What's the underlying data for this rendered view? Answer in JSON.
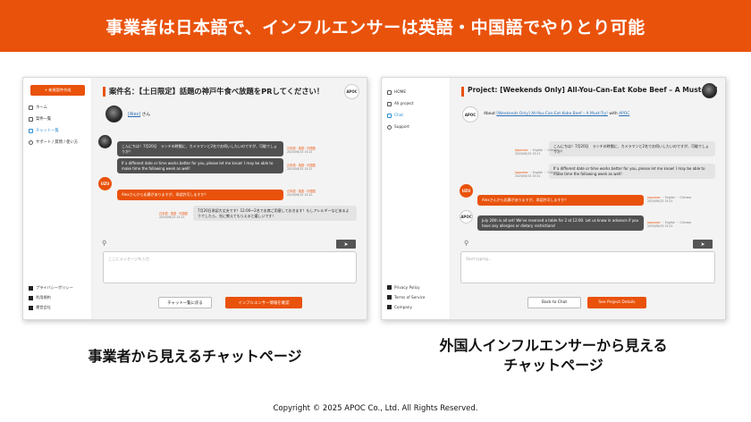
{
  "banner": {
    "text": "事業者は日本語で、インフルエンサーは英語・中国語でやりとり可能"
  },
  "left": {
    "new_button": "+ 新規案件作成",
    "nav": [
      "ホーム",
      "案件一覧",
      "チャット一覧",
      "サポート / 質問 / 使い方"
    ],
    "footer": [
      "プライバシーポリシー",
      "利用規約",
      "運営会社"
    ],
    "title": "案件名：【土日限定】話題の神戸牛食べ放題をPRしてください！",
    "logo": "APOC",
    "partner_prefix": "[Alex]",
    "partner_suffix": " さん",
    "messages": [
      {
        "text": "こんにちは！7月20日　ランチの時間に、カメラマンと2名でお伺いしたいのですが、可能でしょうか？",
        "meta1": "日本語・英語・中国語",
        "meta2": "2025/06/15 15:21"
      },
      {
        "text": "If a different date or time works better for you, please let me know! I may be able to make time the following week as well!",
        "meta1": "日本語・英語・中国語",
        "meta2": "2025/06/15 15:21"
      },
      {
        "text": "Alexさんから応募がありますが、承認許可しますか？",
        "meta1": "日本語・英語・中国語",
        "meta2": "2025/06/15 15:21"
      },
      {
        "text": "7月20日承認大丈夫です！12:00〜2名でお席ご用意しておきます！もしアレルギーなどあるようでしたら、先に教えてもらえると嬉しいです！",
        "meta1": "日本語・英語・中国語",
        "meta2": "2025/06/15 15:21"
      }
    ],
    "uzu": "UZU",
    "placeholder": "ここにメッセージを入力",
    "back_button": "チャット一覧に戻る",
    "info_button": "インフルエンサー情報を確認"
  },
  "right": {
    "nav": [
      "HOME",
      "All project",
      "Chat",
      "Support"
    ],
    "footer": [
      "Privacy Policy",
      "Terms of Service",
      "Company"
    ],
    "title": "Project: [Weekends Only] All-You-Can-Eat Kobe Beef – A Must-Try!",
    "logo": "APOC",
    "about_prefix": "About ",
    "about_link": "[Weekends Only] All-You-Can-Eat Kobe Beef – A Must-Try!",
    "about_mid": " with ",
    "about_company": "APOC",
    "messages": [
      {
        "text": "こんにちは！7月20日　ランチの時間に、カメラマンと2名でお伺いしたいのですが、可能でしょうか？",
        "lang": "Japanese",
        "rest": " ・ English ・ Chinese",
        "time": "2025/06/15 15:21"
      },
      {
        "text": "If a different date or time works better for you, please let me know! I may be able to make time the following week as well!",
        "lang": "Japanese",
        "rest": " ・ English ・ Chinese",
        "time": "2025/06/15 15:21"
      },
      {
        "text": "Alexさんから応募がありますが、承認許可しますか？",
        "lang": "Japanese",
        "rest": " ・ English ・ Chinese",
        "time": "2025/06/15 15:21"
      },
      {
        "text": "July 20th is all set! We've reserved a table for 2 at 12:00. Let us know in advance if you have any allergies or dietary restrictions!",
        "lang": "Japanese",
        "rest": " ・ English ・ Chinese",
        "time": "2025/06/15 15:21"
      }
    ],
    "uzu": "UZU",
    "placeholder": "Start typing...",
    "back_button": "Back to Chat",
    "details_button": "See Project Details"
  },
  "captions": {
    "left": "事業者から見えるチャットページ",
    "right_line1": "外国人インフルエンサーから見える",
    "right_line2": "チャットページ"
  },
  "copyright": "Copyright © 2025 APOC Co., Ltd. All Rights Reserved.",
  "colors": {
    "accent": "#e9520b",
    "link": "#2c6fb5",
    "dark_bubble": "#505050"
  }
}
